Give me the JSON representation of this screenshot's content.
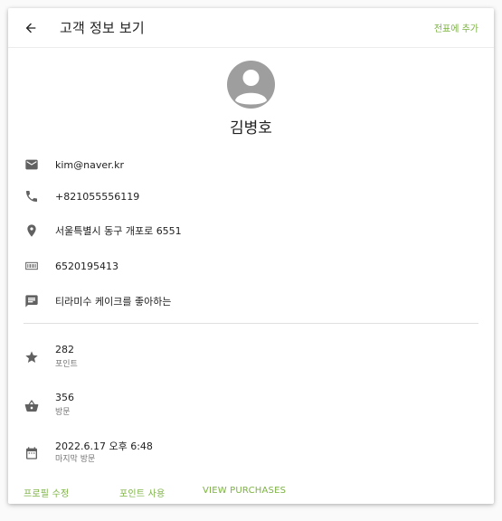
{
  "header": {
    "title": "고객 정보 보기",
    "action": "전표에 추가",
    "back_icon": "arrow-back-icon"
  },
  "customer": {
    "name": "김병호",
    "avatar_icon": "account-circle-icon"
  },
  "details": [
    {
      "icon": "email-icon",
      "value": "kim@naver.kr"
    },
    {
      "icon": "phone-icon",
      "value": "+821055556119"
    },
    {
      "icon": "location-pin-icon",
      "value": "서울특별시 동구 개포로 6551"
    },
    {
      "icon": "barcode-icon",
      "value": "6520195413"
    },
    {
      "icon": "note-icon",
      "value": "티라미수 케이크를 좋아하는"
    }
  ],
  "stats": [
    {
      "icon": "star-icon",
      "value": "282",
      "label": "포인트"
    },
    {
      "icon": "basket-icon",
      "value": "356",
      "label": "방문"
    },
    {
      "icon": "calendar-icon",
      "value": "2022.6.17 오후 6:48",
      "label": "마지막 방문"
    }
  ],
  "footer": {
    "edit_profile": "프로필 수정",
    "use_points": "포인트 사용",
    "view_purchases": "VIEW PURCHASES"
  },
  "colors": {
    "accent": "#7cb342",
    "icon": "#616161",
    "avatar": "#9e9e9e"
  }
}
